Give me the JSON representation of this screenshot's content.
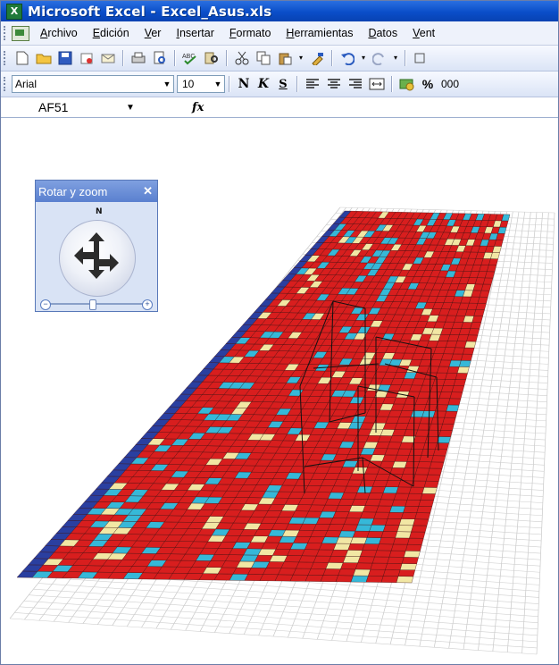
{
  "window": {
    "app_title": "Microsoft Excel - Excel_Asus.xls"
  },
  "menu": {
    "items": [
      {
        "label": "Archivo",
        "ul": "A",
        "rest": "rchivo"
      },
      {
        "label": "Edición",
        "ul": "E",
        "rest": "dición"
      },
      {
        "label": "Ver",
        "ul": "V",
        "rest": "er"
      },
      {
        "label": "Insertar",
        "ul": "I",
        "rest": "nsertar"
      },
      {
        "label": "Formato",
        "ul": "F",
        "rest": "ormato"
      },
      {
        "label": "Herramientas",
        "ul": "H",
        "rest": "erramientas"
      },
      {
        "label": "Datos",
        "ul": "D",
        "rest": "atos"
      },
      {
        "label": "Vent",
        "ul": "V",
        "rest": "ent"
      }
    ]
  },
  "format_toolbar": {
    "font_name": "Arial",
    "font_size": "10",
    "bold": "N",
    "italic": "K",
    "underline": "S",
    "percent": "%",
    "thousands": "000"
  },
  "formula_bar": {
    "name_box": "AF51",
    "fx": "fx"
  },
  "rotate_panel": {
    "title": "Rotar y zoom",
    "north": "N",
    "zoom_level": 0.45
  },
  "colors": {
    "red_cell": "#d81e1e",
    "cyan_cell": "#36b8d8",
    "yellow_cell": "#f2e7a4",
    "edge_blue": "#2a3fa0"
  }
}
